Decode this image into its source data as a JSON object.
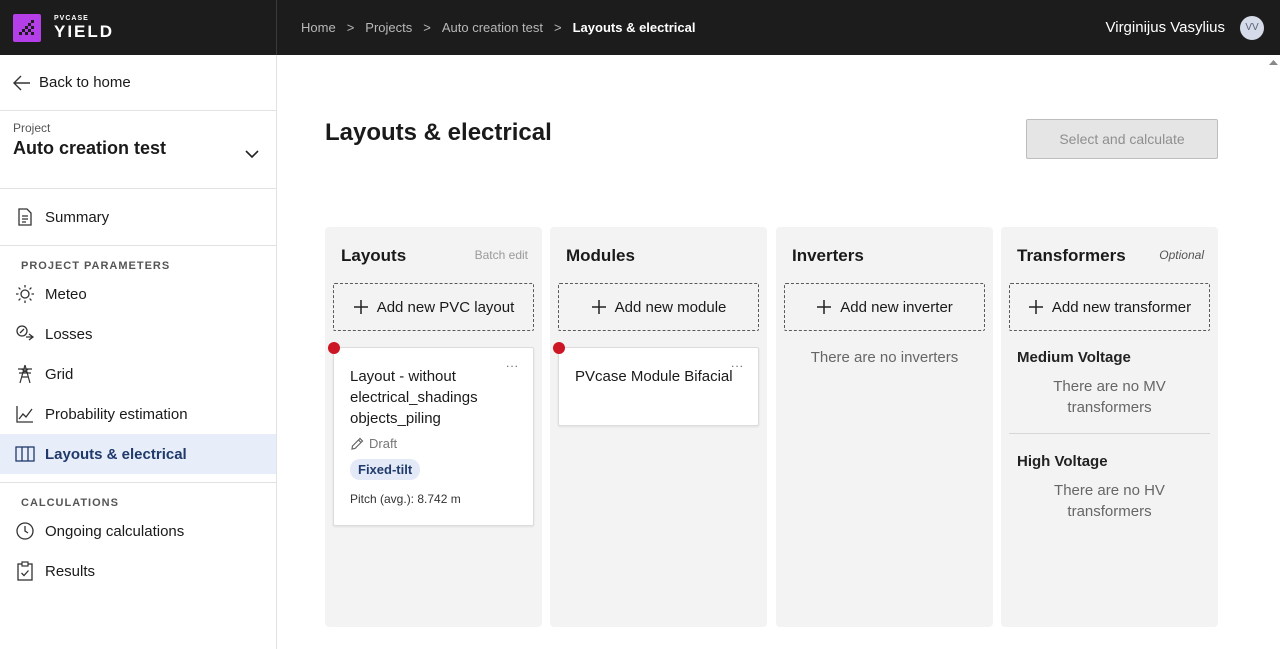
{
  "app": {
    "logo_small": "PVCASE",
    "logo_big": "YIELD"
  },
  "breadcrumb": {
    "items": [
      "Home",
      "Projects",
      "Auto creation test"
    ],
    "current": "Layouts & electrical",
    "sep": ">"
  },
  "user": {
    "name": "Virginijus Vasylius",
    "initials": "VV"
  },
  "sidebar": {
    "back_label": "Back to home",
    "project_caption": "Project",
    "project_name": "Auto creation test",
    "summary": "Summary",
    "params_label": "PROJECT PARAMETERS",
    "params": [
      "Meteo",
      "Losses",
      "Grid",
      "Probability estimation",
      "Layouts & electrical"
    ],
    "calc_label": "CALCULATIONS",
    "calcs": [
      "Ongoing calculations",
      "Results"
    ]
  },
  "main": {
    "title": "Layouts & electrical",
    "calc_button": "Select and calculate",
    "layouts": {
      "title": "Layouts",
      "aux": "Batch edit",
      "add": "Add new PVC layout",
      "card": {
        "title": "Layout - without electrical_shadings objects_piling",
        "status": "Draft",
        "tag": "Fixed-tilt",
        "pitch": "Pitch (avg.): 8.742 m",
        "menu": "..."
      }
    },
    "modules": {
      "title": "Modules",
      "add": "Add new module",
      "card": {
        "title": "PVcase Module Bifacial",
        "menu": "..."
      }
    },
    "inverters": {
      "title": "Inverters",
      "add": "Add new inverter",
      "empty": "There are no inverters"
    },
    "transformers": {
      "title": "Transformers",
      "aux": "Optional",
      "add": "Add new transformer",
      "mv_title": "Medium Voltage",
      "mv_empty": "There are no MV transformers",
      "hv_title": "High Voltage",
      "hv_empty": "There are no HV transformers"
    }
  },
  "colors": {
    "topbar": "#1c1c1c",
    "logo": "#b43ee8",
    "active_bg": "#e8eef9",
    "error_dot": "#cc1525",
    "tag_bg": "#e3e9f7"
  }
}
